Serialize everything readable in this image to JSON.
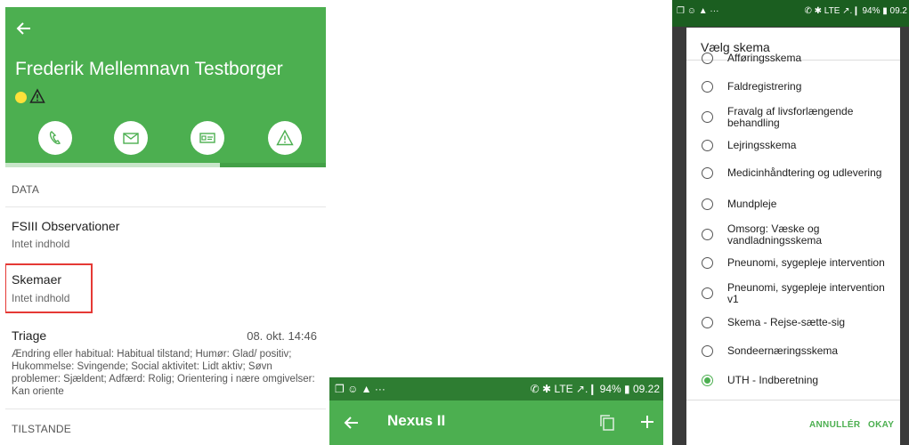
{
  "left": {
    "person_name": "Frederik Mellemnavn Testborger",
    "tab_progress": 0.67,
    "section_data": "DATA",
    "items": [
      {
        "title": "FSIII Observationer",
        "subtitle": "Intet indhold"
      },
      {
        "title": "Skemaer",
        "subtitle": "Intet indhold"
      }
    ],
    "triage": {
      "title": "Triage",
      "date": "08. okt. 14:46",
      "body": "Ændring eller habitual: Habitual tilstand; Humør: Glad/ positiv; Hukommelse: Svingende; Social aktivitet: Lidt aktiv; Søvn problemer: Sjældent; Adfærd: Rolig; Orientering i nære omgivelser: Kan oriente"
    },
    "section_tilstande": "TILSTANDE",
    "colors": {
      "header": "#4caf50",
      "status_dot": "#ffe13a",
      "highlight": "#e53935"
    }
  },
  "middle": {
    "status_left": "❐ ☺ ▲ ···",
    "status_right": "✆ ✱ LTE ↗.❙ 94% ▮ 09.22",
    "title": "Nexus II"
  },
  "right": {
    "status_left": "❐ ☺ ▲ ···",
    "status_right": "✆ ✱ LTE ↗.❙ 94% ▮ 09.2",
    "dialog_title": "Vælg skema",
    "options": [
      {
        "label": "Afføringsskema",
        "selected": false
      },
      {
        "label": "Faldregistrering",
        "selected": false
      },
      {
        "label": "Fravalg af livsforlængende behandling",
        "selected": false
      },
      {
        "label": "Lejringsskema",
        "selected": false
      },
      {
        "label": "Medicinhåndtering og udlevering",
        "selected": false
      },
      {
        "label": "Mundpleje",
        "selected": false
      },
      {
        "label": "Omsorg: Væske og vandladningsskema",
        "selected": false
      },
      {
        "label": "Pneunomi, sygepleje intervention",
        "selected": false
      },
      {
        "label": "Pneunomi, sygepleje intervention v1",
        "selected": false
      },
      {
        "label": "Skema - Rejse-sætte-sig",
        "selected": false
      },
      {
        "label": "Sondeernæringsskema",
        "selected": false
      },
      {
        "label": "UTH - Indberetning",
        "selected": true
      }
    ],
    "cancel_label": "ANNULLÉR",
    "ok_label": "OKAY",
    "accent_color": "#4caf50"
  }
}
